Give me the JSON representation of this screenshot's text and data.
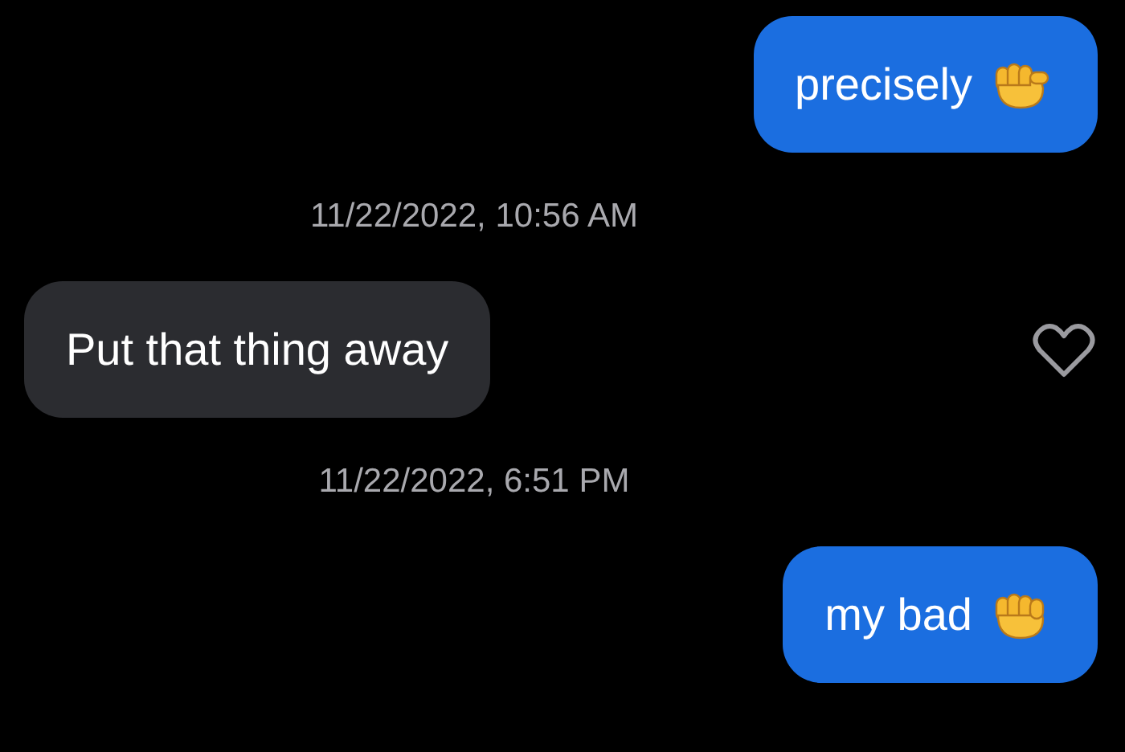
{
  "messages": [
    {
      "kind": "sent",
      "text": "precisely"
    },
    {
      "kind": "timestamp",
      "text": "11/22/2022, 10:56 AM"
    },
    {
      "kind": "received",
      "text": "Put that thing away",
      "liked": false
    },
    {
      "kind": "timestamp",
      "text": "11/22/2022, 6:51 PM"
    },
    {
      "kind": "sent",
      "text": "my bad"
    }
  ]
}
